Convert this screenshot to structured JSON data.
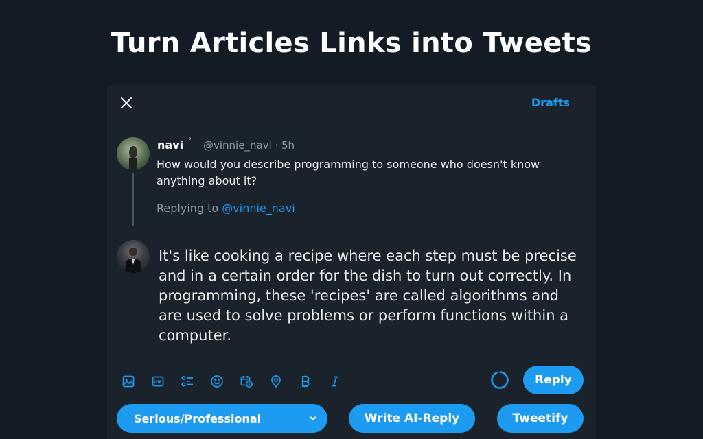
{
  "headline": "Turn Articles Links into Tweets",
  "header": {
    "drafts_label": "Drafts"
  },
  "original_tweet": {
    "name": "navi",
    "verified_mark": "°",
    "handle_time": "@vinnie_navi · 5h",
    "text": "How would you describe programming to someone who doesn't know anything about it?",
    "replying_prefix": "Replying to",
    "replying_handle": "@vinnie_navi"
  },
  "reply_draft": {
    "text": "It's like cooking a recipe where each step must be precise and in a certain order for the dish to turn out correctly. In programming, these 'recipes' are called algorithms and are used to solve problems or perform functions within a computer."
  },
  "toolbar": {
    "icons": [
      "image-icon",
      "gif-icon",
      "poll-icon",
      "emoji-icon",
      "schedule-icon",
      "location-icon",
      "bold-icon",
      "italic-icon"
    ],
    "reply_label": "Reply"
  },
  "extension": {
    "tone_selected": "Serious/Professional",
    "write_ai_label": "Write AI-Reply",
    "tweetify_label": "Tweetify"
  },
  "colors": {
    "accent": "#1d9bf0",
    "background": "#131b24",
    "modal": "#1a232c",
    "muted_text": "#8b98a5"
  }
}
